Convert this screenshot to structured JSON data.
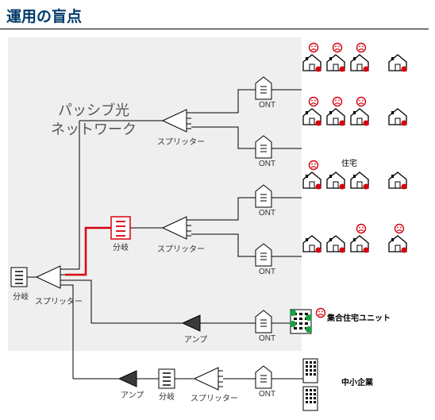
{
  "title": "運用の盲点",
  "pon_label_l1": "パッシブ光",
  "pon_label_l2": "ネットワーク",
  "labels": {
    "bunki": "分岐",
    "splitter": "スプリッター",
    "amp": "アンプ",
    "ont": "ONT",
    "house": "住宅",
    "mdu": "集合住宅ユニット",
    "sme": "中小企業"
  },
  "colors": {
    "accent": "#d8000e",
    "line": "#000",
    "box": "#fff",
    "gray": "#777"
  },
  "branches": [
    {
      "id": "top",
      "endpoints": [
        "ont",
        "ont"
      ],
      "houses_2x4": true,
      "sad_rows": [
        0,
        1
      ]
    },
    {
      "id": "mid",
      "endpoints": [
        "ont",
        "ont"
      ],
      "houses_2x4": true,
      "sad_rows": [
        2,
        3
      ],
      "highlight_first_bunki": true,
      "house_header": "住宅"
    },
    {
      "id": "mdu",
      "endpoints": [
        "ont"
      ],
      "mdu": true
    },
    {
      "id": "sme",
      "endpoints": [
        "ont"
      ],
      "sme": true
    }
  ]
}
